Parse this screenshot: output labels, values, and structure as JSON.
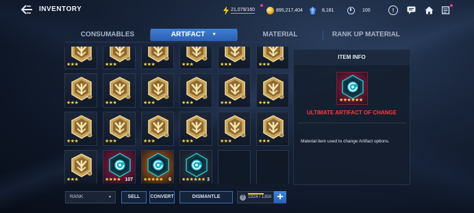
{
  "header": {
    "back_icon": "back-arrow-icon",
    "title": "INVENTORY",
    "energy": "21,079/160",
    "gold": "895,217,404",
    "crystals": "8,181",
    "stamina": "100"
  },
  "tabs": [
    {
      "label": "CONSUMABLES",
      "active": false
    },
    {
      "label": "ARTIFACT",
      "active": true
    },
    {
      "label": "MATERIAL",
      "active": false
    },
    {
      "label": "RANK UP MATERIAL",
      "active": false
    }
  ],
  "grid": {
    "rows": [
      [
        {
          "type": "artifact",
          "stars": "★★★"
        },
        {
          "type": "artifact",
          "stars": "★★★"
        },
        {
          "type": "artifact",
          "stars": "★★★"
        },
        {
          "type": "artifact",
          "stars": "★★★"
        },
        {
          "type": "artifact",
          "stars": "★★★"
        },
        {
          "type": "artifact",
          "stars": "★★★"
        }
      ],
      [
        {
          "type": "artifact",
          "stars": "★★★"
        },
        {
          "type": "artifact",
          "stars": "★★★"
        },
        {
          "type": "artifact",
          "stars": "★★★"
        },
        {
          "type": "artifact",
          "stars": "★★★"
        },
        {
          "type": "artifact",
          "stars": "★★★"
        },
        {
          "type": "artifact",
          "stars": "★★★"
        }
      ],
      [
        {
          "type": "artifact",
          "stars": "★★★"
        },
        {
          "type": "artifact",
          "stars": "★★★"
        },
        {
          "type": "artifact",
          "stars": "★★★"
        },
        {
          "type": "artifact",
          "stars": "★★★"
        },
        {
          "type": "artifact",
          "stars": "★★★"
        },
        {
          "type": "artifact",
          "stars": "★★★"
        }
      ],
      [
        {
          "type": "artifact",
          "stars": "★★★"
        },
        {
          "type": "change",
          "glow": "red",
          "stars": "★★★★",
          "count": "107"
        },
        {
          "type": "change",
          "glow": "orange",
          "stars": "★★★★★",
          "count": "6"
        },
        {
          "type": "change",
          "glow": "dark",
          "stars": "★★★★★★",
          "count": "3"
        },
        {
          "type": "empty"
        },
        {
          "type": "empty"
        }
      ]
    ]
  },
  "item_info": {
    "header": "ITEM INFO",
    "stars": "★★★★★★",
    "name": "ULTIMATE ARTIFACT OF CHANGE",
    "description": "Material item used to change Artifact options."
  },
  "bottom": {
    "rank_select": "RANK",
    "sell": "SELL",
    "convert": "CONVERT",
    "dismantle": "DISMANTLE",
    "capacity": "1024 / 1350",
    "capacity_fraction": 0.76
  },
  "colors": {
    "accent": "#3f7fd4",
    "item_name": "#ff3b3b",
    "star": "#ffd84a"
  }
}
